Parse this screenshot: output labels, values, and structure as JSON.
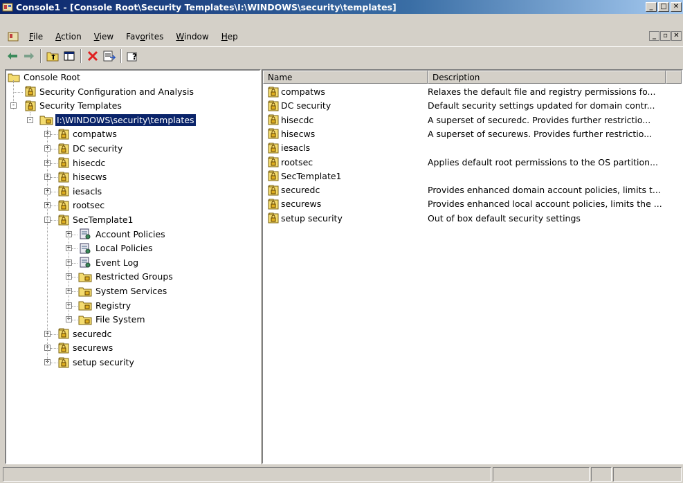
{
  "window": {
    "title": "Console1 - [Console Root\\Security Templates\\I:\\WINDOWS\\security\\templates]"
  },
  "menu": [
    {
      "label": "File",
      "accel": "F"
    },
    {
      "label": "Action",
      "accel": "A"
    },
    {
      "label": "View",
      "accel": "V"
    },
    {
      "label": "Favorites",
      "accel": "o"
    },
    {
      "label": "Window",
      "accel": "W"
    },
    {
      "label": "Hep",
      "accel": "H"
    }
  ],
  "toolbar": [
    "back-arrow",
    "forward-arrow",
    "up-folder",
    "show-hide-tree",
    "delete",
    "export-list",
    "help"
  ],
  "tree": {
    "root": "Console Root",
    "sca": "Security Configuration and Analysis",
    "templates": "Security Templates",
    "path": "I:\\WINDOWS\\security\\templates",
    "items": [
      {
        "label": "compatws",
        "expander": "+"
      },
      {
        "label": "DC security",
        "expander": "+"
      },
      {
        "label": "hisecdc",
        "expander": "+"
      },
      {
        "label": "hisecws",
        "expander": "+"
      },
      {
        "label": "iesacls",
        "expander": "+"
      },
      {
        "label": "rootsec",
        "expander": "+"
      },
      {
        "label": "SecTemplate1",
        "expander": "-"
      }
    ],
    "sec_children": [
      {
        "label": "Account Policies",
        "icon": "policy-icon"
      },
      {
        "label": "Local Policies",
        "icon": "policy-icon"
      },
      {
        "label": "Event Log",
        "icon": "policy-icon"
      },
      {
        "label": "Restricted Groups",
        "icon": "folder-icon"
      },
      {
        "label": "System Services",
        "icon": "folder-icon"
      },
      {
        "label": "Registry",
        "icon": "folder-icon"
      },
      {
        "label": "File System",
        "icon": "folder-icon"
      }
    ],
    "items_after": [
      {
        "label": "securedc",
        "expander": "+"
      },
      {
        "label": "securews",
        "expander": "+"
      },
      {
        "label": "setup security",
        "expander": "+"
      }
    ]
  },
  "list": {
    "headers": {
      "name": "Name",
      "description": "Description"
    },
    "rows": [
      {
        "name": "compatws",
        "description": "Relaxes the default file and registry permissions fo..."
      },
      {
        "name": "DC security",
        "description": "Default security settings updated for domain contr..."
      },
      {
        "name": "hisecdc",
        "description": "A superset of securedc. Provides further restrictio..."
      },
      {
        "name": "hisecws",
        "description": "A superset of securews. Provides further restrictio..."
      },
      {
        "name": "iesacls",
        "description": ""
      },
      {
        "name": "rootsec",
        "description": "Applies default root permissions to the OS partition..."
      },
      {
        "name": "SecTemplate1",
        "description": ""
      },
      {
        "name": "securedc",
        "description": "Provides enhanced domain account policies, limits t..."
      },
      {
        "name": "securews",
        "description": "Provides enhanced local account policies, limits the ..."
      },
      {
        "name": "setup security",
        "description": "Out of box default security settings"
      }
    ]
  }
}
